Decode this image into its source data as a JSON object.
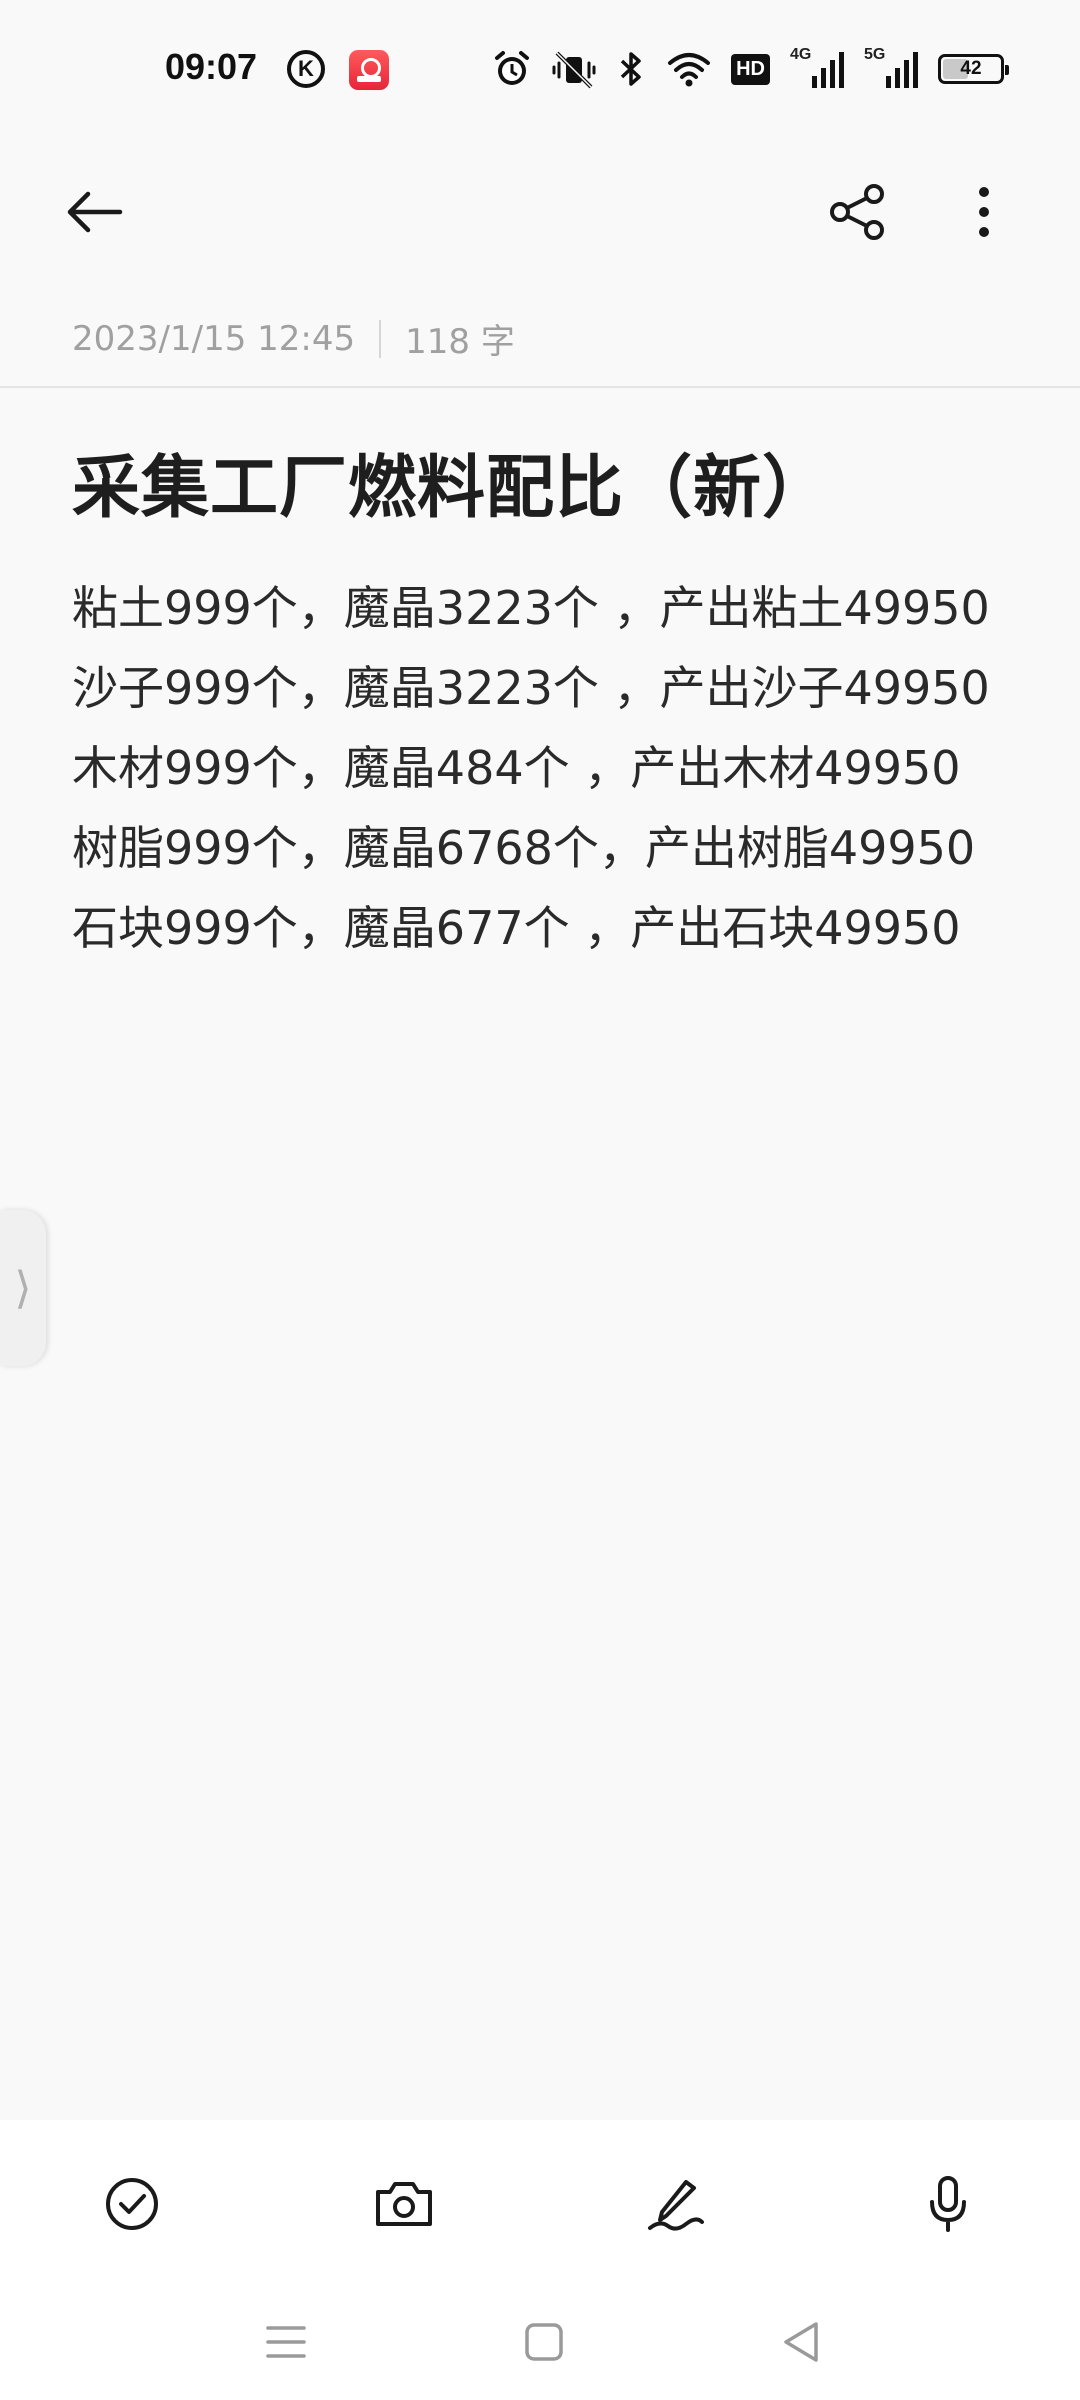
{
  "status_bar": {
    "time": "09:07",
    "k_badge": "K",
    "hd_label": "HD",
    "signal_1": "4G",
    "signal_2": "5G",
    "battery_level": "42",
    "icons": [
      "alarm-icon",
      "vibrate-off-icon",
      "bluetooth-icon",
      "wifi-icon"
    ]
  },
  "toolbar": {
    "back_icon": "arrow-left-icon",
    "share_icon": "share-icon",
    "more_icon": "more-vertical-icon"
  },
  "note": {
    "date": "2023/1/15 12:45",
    "word_count": "118 字",
    "title": "采集工厂燃料配比（新）",
    "lines": [
      "粘土999个，魔晶3223个 ，产出粘土49950",
      "沙子999个，魔晶3223个 ，产出沙子49950",
      "木材999个，魔晶484个 ，产出木材49950",
      "树脂999个，魔晶6768个，产出树脂49950",
      "石块999个，魔晶677个 ，产出石块49950"
    ]
  },
  "edge_handle": {
    "glyph": "⟩"
  },
  "bottom_tools": [
    "checklist-icon",
    "camera-icon",
    "handwriting-icon",
    "microphone-icon"
  ],
  "nav_bar": [
    "recents-icon",
    "home-icon",
    "back-triangle-icon"
  ]
}
